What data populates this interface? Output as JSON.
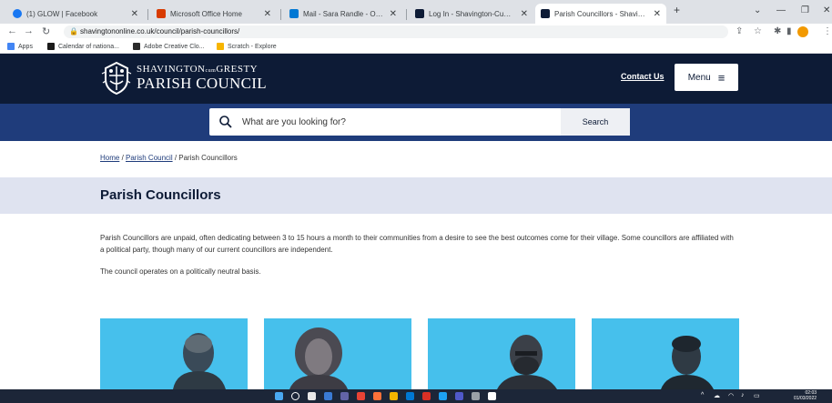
{
  "browser": {
    "tabs": [
      {
        "title": "(1) GLOW | Facebook",
        "favicon_color": "#1877f2"
      },
      {
        "title": "Microsoft Office Home",
        "favicon_color": "#d83b01"
      },
      {
        "title": "Mail - Sara Randle - Outlook",
        "favicon_color": "#0078d4"
      },
      {
        "title": "Log In - Shavington-Cum-Gresty",
        "favicon_color": "#0d1b36"
      },
      {
        "title": "Parish Councillors - Shavington-",
        "favicon_color": "#0d1b36"
      }
    ],
    "new_tab": "+",
    "url": "shavingtononline.co.uk/council/parish-councillors/",
    "bookmarks": [
      {
        "label": "Apps",
        "icon_color": "#4285f4"
      },
      {
        "label": "Calendar of nationa...",
        "icon_color": "#1a1a1a"
      },
      {
        "label": "Adobe Creative Clo...",
        "icon_color": "#2b2b2b"
      },
      {
        "label": "Scratch - Explore",
        "icon_color": "#f7b500"
      }
    ]
  },
  "site": {
    "logo_line1": "SHAVINGTON",
    "logo_cum": "cum",
    "logo_line1b": "GRESTY",
    "logo_line2": "PARISH COUNCIL",
    "contact_label": "Contact Us",
    "menu_label": "Menu",
    "menu_icon": "≡"
  },
  "search": {
    "placeholder": "What are you looking for?",
    "button_label": "Search"
  },
  "breadcrumb": {
    "home": "Home",
    "sep1": " / ",
    "parish": "Parish Council",
    "sep2": " / ",
    "current": "Parish Councillors"
  },
  "page": {
    "title": "Parish Councillors",
    "intro": "Parish Councillors are unpaid, often dedicating between 3 to 15 hours a month to their communities from a desire to see the best outcomes come for their village. Some councillors are affiliated with a political party, though many of our current councillors are independent.",
    "note": "The council operates on a politically neutral basis."
  },
  "cards_accent": "#46c0ec",
  "taskbar": {
    "time": "02:03",
    "date": "01/03/2022"
  },
  "colors": {
    "header_navy": "#0d1b36",
    "search_band": "#1f3c7b",
    "title_band": "#dfe3f0"
  }
}
